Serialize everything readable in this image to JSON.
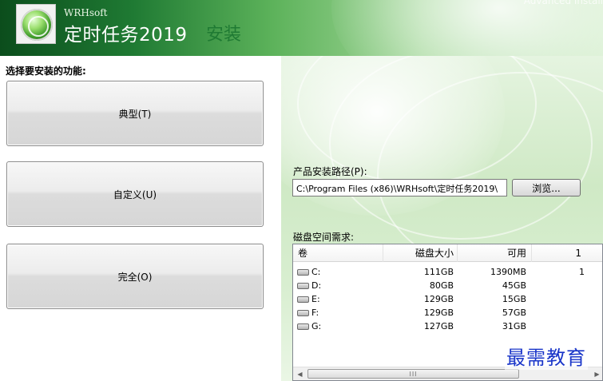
{
  "header": {
    "brand": "WRHsoft",
    "product": "定时任务2019",
    "step_title": "安装",
    "corner_watermark": "Advanced Install"
  },
  "features": {
    "label": "选择要安装的功能:",
    "buttons": [
      "典型(T)",
      "自定义(U)",
      "完全(O)"
    ]
  },
  "install_path": {
    "label": "产品安装路径(P):",
    "value": "C:\\Program Files (x86)\\WRHsoft\\定时任务2019\\",
    "browse_label": "浏览..."
  },
  "disk": {
    "label": "磁盘空间需求:",
    "columns": [
      "卷",
      "磁盘大小",
      "可用",
      "1"
    ],
    "rows": [
      {
        "volume": "C:",
        "size": "111GB",
        "available": "1390MB",
        "extra": "1"
      },
      {
        "volume": "D:",
        "size": "80GB",
        "available": "45GB",
        "extra": ""
      },
      {
        "volume": "E:",
        "size": "129GB",
        "available": "15GB",
        "extra": ""
      },
      {
        "volume": "F:",
        "size": "129GB",
        "available": "57GB",
        "extra": ""
      },
      {
        "volume": "G:",
        "size": "127GB",
        "available": "31GB",
        "extra": ""
      }
    ],
    "scroll_grip": "III"
  },
  "watermark": "最需教育"
}
